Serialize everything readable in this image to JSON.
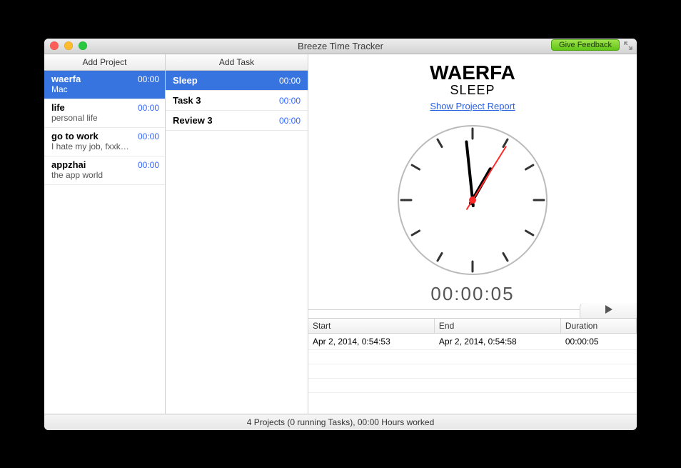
{
  "window": {
    "title": "Breeze Time Tracker",
    "feedback_label": "Give Feedback"
  },
  "sidebar": {
    "add_project_label": "Add Project",
    "projects": [
      {
        "name": "waerfa",
        "desc": "Mac",
        "time": "00:00",
        "selected": true
      },
      {
        "name": "life",
        "desc": "personal life",
        "time": "00:00",
        "selected": false
      },
      {
        "name": "go to work",
        "desc": "I hate my job, fxxk…",
        "time": "00:00",
        "selected": false
      },
      {
        "name": "appzhai",
        "desc": "the app world",
        "time": "00:00",
        "selected": false
      }
    ]
  },
  "tasks_panel": {
    "add_task_label": "Add Task",
    "tasks": [
      {
        "name": "Sleep",
        "time": "00:00",
        "selected": true
      },
      {
        "name": "Task 3",
        "time": "00:00",
        "selected": false
      },
      {
        "name": "Review 3",
        "time": "00:00",
        "selected": false
      }
    ]
  },
  "detail": {
    "project_title": "WAERFA",
    "task_title": "SLEEP",
    "report_link": "Show Project Report",
    "timer": "00:00:05"
  },
  "clock": {
    "hour_angle": 30,
    "minute_angle": 354,
    "second_angle": 32
  },
  "log": {
    "headers": {
      "start": "Start",
      "end": "End",
      "duration": "Duration"
    },
    "rows": [
      {
        "start": "Apr 2, 2014, 0:54:53",
        "end": "Apr 2, 2014, 0:54:58",
        "duration": "00:00:05"
      }
    ]
  },
  "statusbar": {
    "text": "4 Projects (0 running Tasks), 00:00 Hours worked"
  }
}
